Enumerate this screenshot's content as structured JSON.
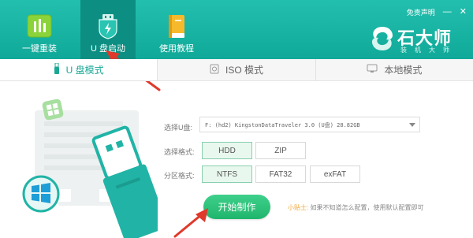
{
  "header": {
    "nav": [
      {
        "label": "一键重装",
        "icon": "bar-chart-icon"
      },
      {
        "label": "U 盘启动",
        "icon": "usb-shield-icon"
      },
      {
        "label": "使用教程",
        "icon": "book-icon"
      }
    ],
    "disclaimer": "免责声明",
    "window_controls": {
      "minimize": "—",
      "close": "✕"
    },
    "brand": {
      "name": "石大师",
      "sub": "装机大师",
      "icon": "swirl-logo-icon"
    }
  },
  "tabs": [
    {
      "label": "U 盘模式",
      "icon": "usb-drive-icon"
    },
    {
      "label": "ISO 模式",
      "icon": "disc-file-icon"
    },
    {
      "label": "本地模式",
      "icon": "monitor-icon"
    }
  ],
  "form": {
    "drive_label": "选择U盘:",
    "drive_value": "F: (hd2) KingstonDataTraveler 3.0 (U盘) 28.82GB",
    "format_label": "选择格式:",
    "formats": [
      "HDD",
      "ZIP"
    ],
    "partition_label": "分区格式:",
    "partitions": [
      "NTFS",
      "FAT32",
      "exFAT"
    ],
    "start_button": "开始制作",
    "tip_title": "小贴士:",
    "tip_text": "如果不知道怎么配置，使用默认配置即可"
  },
  "colors": {
    "header_teal": "#17b3a3",
    "active_nav": "#0c8f82",
    "accent_green": "#2dbf78",
    "selected_option_bg": "#e9f8ee",
    "arrow_red": "#e0392b",
    "tip_orange": "#f0a73a"
  }
}
